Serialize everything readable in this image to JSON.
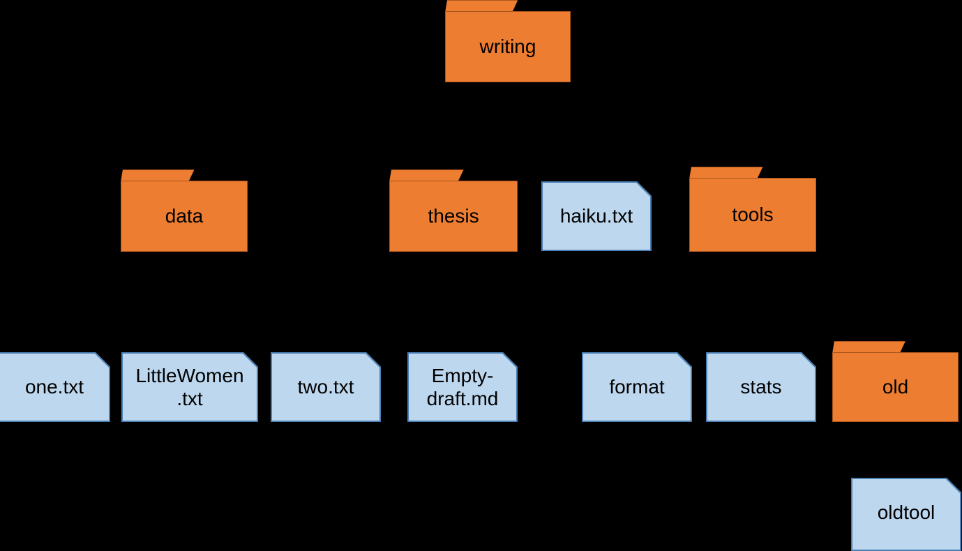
{
  "diagram": {
    "title": "writing directory file tree",
    "background_color": "#000000",
    "folder_fill": "#ED7D31",
    "folder_border": "#A9551C",
    "file_fill": "#BDD7EE",
    "file_border": "#4B80B5",
    "text_color": "#000000"
  },
  "nodes": {
    "writing": {
      "label": "writing",
      "kind": "folder",
      "level": 0
    },
    "data": {
      "label": "data",
      "kind": "folder",
      "level": 1
    },
    "thesis": {
      "label": "thesis",
      "kind": "folder",
      "level": 1
    },
    "haiku": {
      "label": "haiku.txt",
      "kind": "file",
      "level": 1
    },
    "tools": {
      "label": "tools",
      "kind": "folder",
      "level": 1
    },
    "one": {
      "label": "one.txt",
      "kind": "file",
      "level": 2
    },
    "littlewomen": {
      "label": "LittleWomen\n.txt",
      "kind": "file",
      "level": 2
    },
    "two": {
      "label": "two.txt",
      "kind": "file",
      "level": 2
    },
    "emptydraft": {
      "label": "Empty-\ndraft.md",
      "kind": "file",
      "level": 2
    },
    "format": {
      "label": "format",
      "kind": "file",
      "level": 2
    },
    "stats": {
      "label": "stats",
      "kind": "file",
      "level": 2
    },
    "old": {
      "label": "old",
      "kind": "folder",
      "level": 2
    },
    "oldtool": {
      "label": "oldtool",
      "kind": "file",
      "level": 3
    }
  }
}
